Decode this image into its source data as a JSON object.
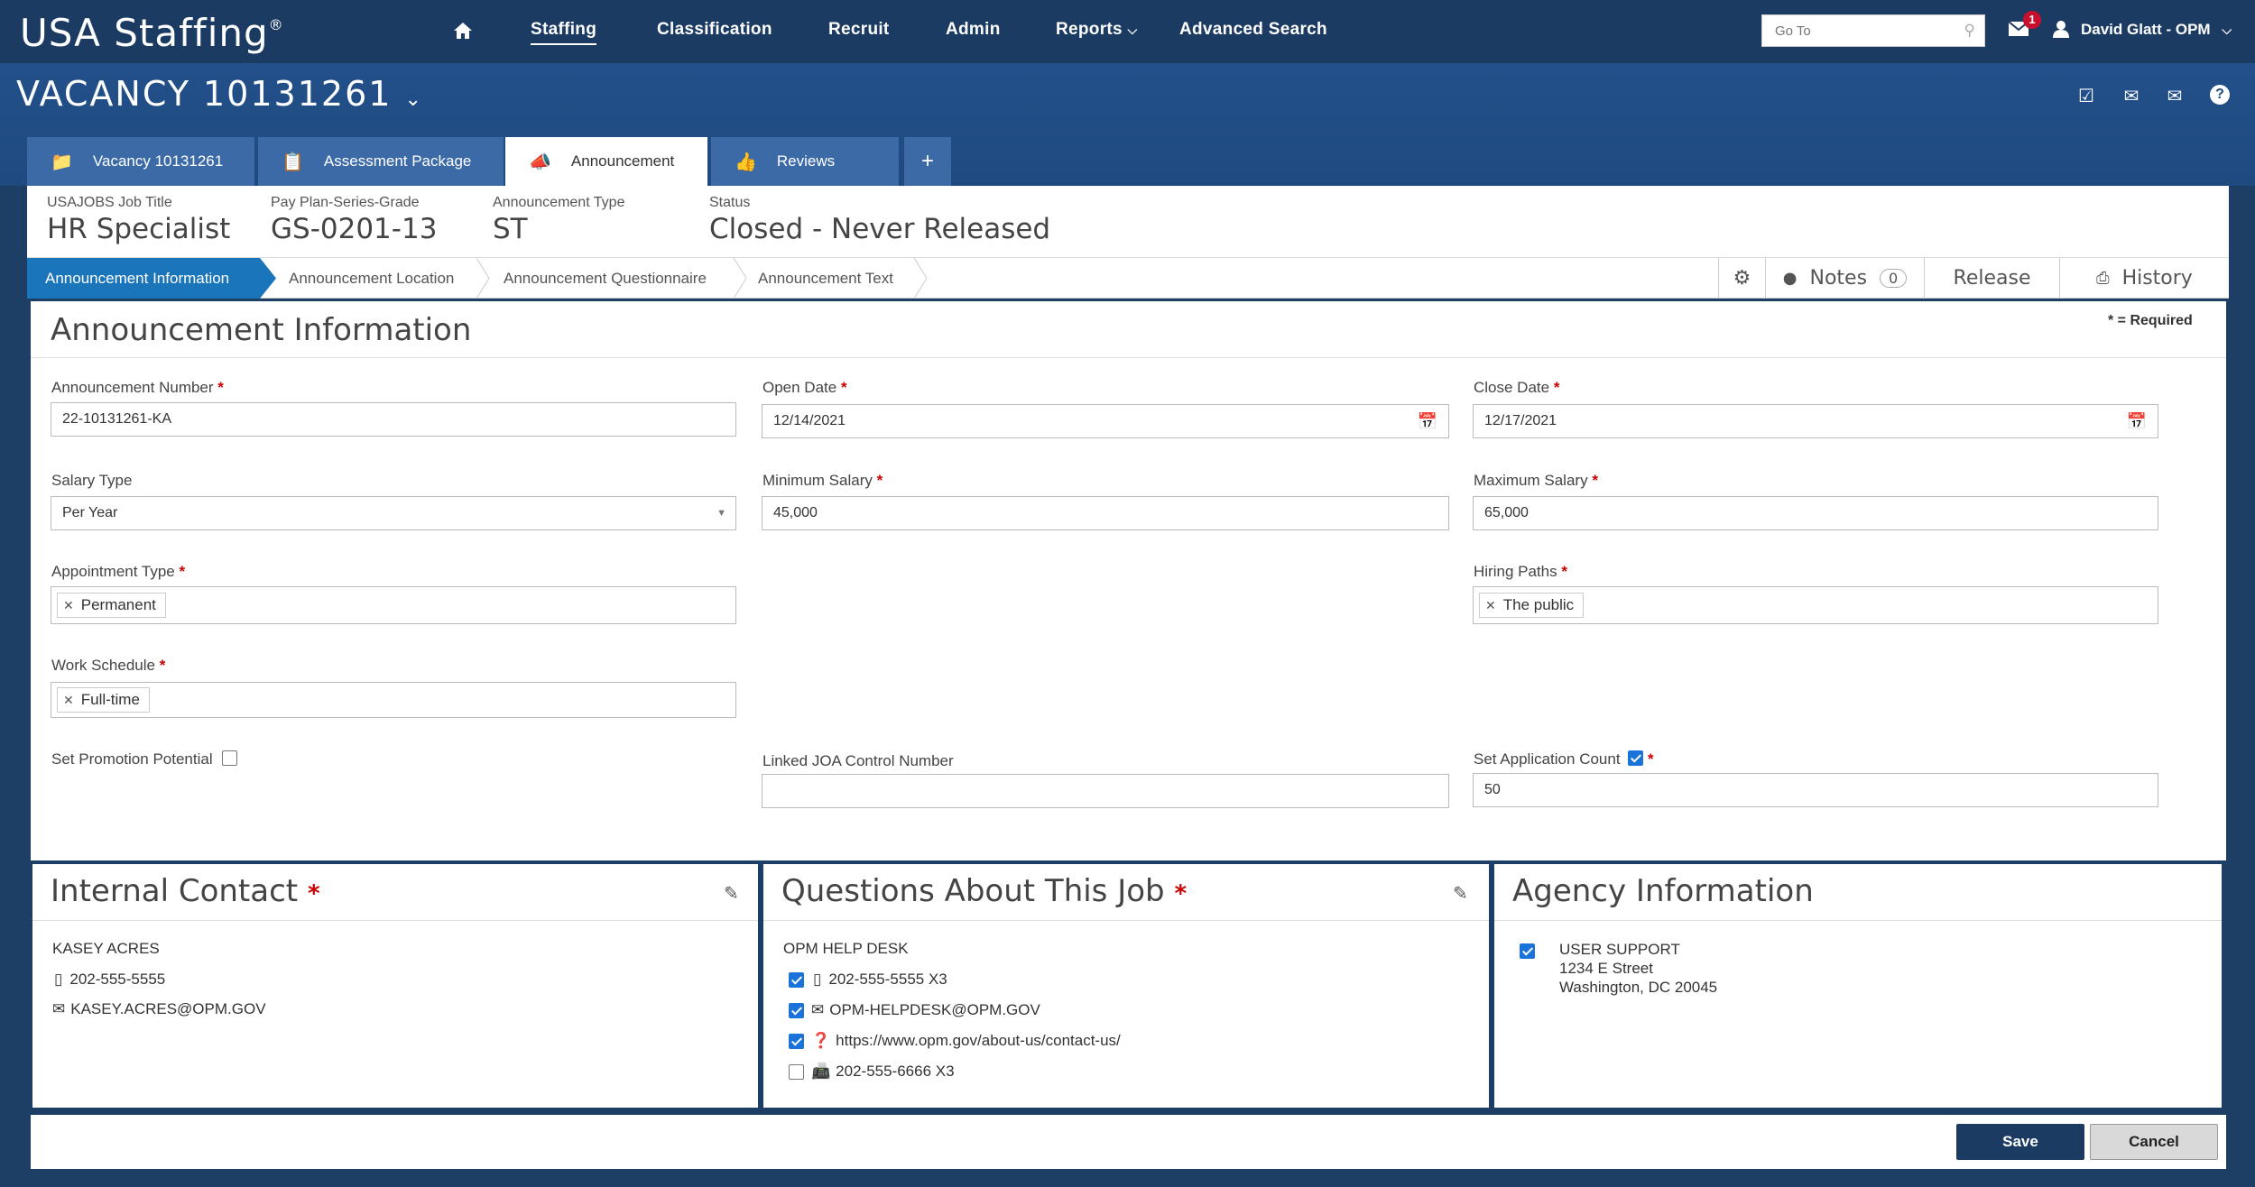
{
  "app": {
    "logo": "USA Staffing",
    "logo_mark": "®"
  },
  "nav": {
    "items": [
      "Staffing",
      "Classification",
      "Recruit",
      "Admin",
      "Reports",
      "Advanced Search"
    ],
    "goto_placeholder": "Go To",
    "mail_badge": "1",
    "user": "David Glatt - OPM"
  },
  "vacancy": {
    "title": "VACANCY 10131261"
  },
  "tabs": [
    "Vacancy 10131261",
    "Assessment Package",
    "Announcement",
    "Reviews",
    "+"
  ],
  "summary": {
    "job_title_label": "USAJOBS Job Title",
    "job_title": "HR Specialist",
    "ppsg_label": "Pay Plan-Series-Grade",
    "ppsg": "GS-0201-13",
    "type_label": "Announcement Type",
    "type": "ST",
    "status_label": "Status",
    "status": "Closed - Never Released"
  },
  "subtabs": [
    "Announcement Information",
    "Announcement Location",
    "Announcement Questionnaire",
    "Announcement Text"
  ],
  "subactions": {
    "notes": "Notes",
    "notes_count": "0",
    "release": "Release",
    "history": "History"
  },
  "form": {
    "title": "Announcement Information",
    "required_note": "* = Required",
    "announcement_number_label": "Announcement Number",
    "announcement_number": "22-10131261-KA",
    "open_date_label": "Open Date",
    "open_date": "12/14/2021",
    "close_date_label": "Close Date",
    "close_date": "12/17/2021",
    "salary_type_label": "Salary Type",
    "salary_type": "Per Year",
    "min_salary_label": "Minimum Salary",
    "min_salary": "45,000",
    "max_salary_label": "Maximum Salary",
    "max_salary": "65,000",
    "appointment_type_label": "Appointment Type",
    "appointment_type": "Permanent",
    "hiring_paths_label": "Hiring Paths",
    "hiring_path": "The public",
    "work_schedule_label": "Work Schedule",
    "work_schedule": "Full-time",
    "promotion_label": "Set Promotion Potential",
    "linked_joa_label": "Linked JOA Control Number",
    "linked_joa": "",
    "app_count_label": "Set Application Count",
    "app_count": "50"
  },
  "internal_contact": {
    "title": "Internal Contact",
    "name": "KASEY ACRES",
    "phone": "202-555-5555",
    "email": "KASEY.ACRES@OPM.GOV"
  },
  "questions": {
    "title": "Questions About This Job",
    "name": "OPM HELP DESK",
    "phone": "202-555-5555 X3",
    "email": "OPM-HELPDESK@OPM.GOV",
    "url": "https://www.opm.gov/about-us/contact-us/",
    "fax": "202-555-6666 X3"
  },
  "agency": {
    "title": "Agency Information",
    "name": "USER SUPPORT",
    "street": "1234 E Street",
    "city": "Washington, DC 20045"
  },
  "footer": {
    "save": "Save",
    "cancel": "Cancel"
  }
}
